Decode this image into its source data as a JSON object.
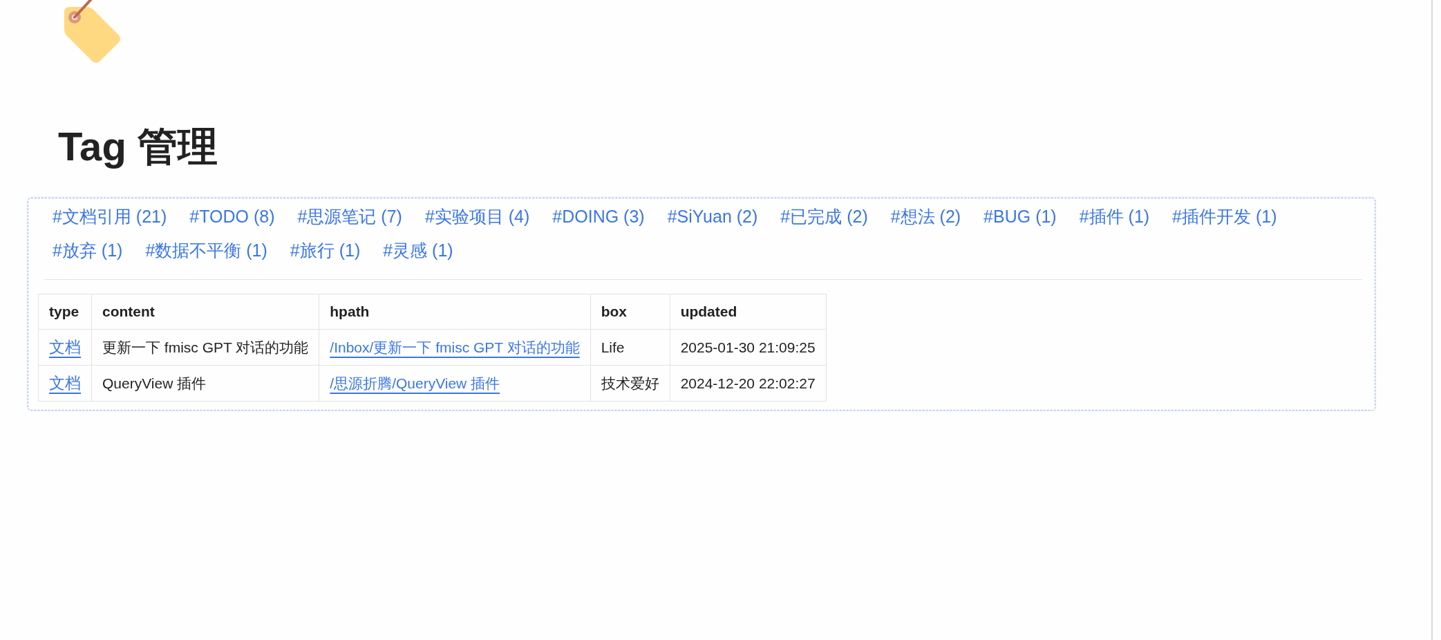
{
  "title": "Tag 管理",
  "tags": [
    "#文档引用 (21)",
    "#TODO (8)",
    "#思源笔记 (7)",
    "#实验项目 (4)",
    "#DOING (3)",
    "#SiYuan (2)",
    "#已完成 (2)",
    "#想法 (2)",
    "#BUG (1)",
    "#插件 (1)",
    "#插件开发 (1)",
    "#放弃 (1)",
    "#数据不平衡 (1)",
    "#旅行 (1)",
    "#灵感 (1)"
  ],
  "table": {
    "columns": [
      "type",
      "content",
      "hpath",
      "box",
      "updated"
    ],
    "rows": [
      {
        "type": "文档",
        "content": "更新一下 fmisc GPT 对话的功能",
        "hpath": "/Inbox/更新一下 fmisc GPT 对话的功能",
        "box": "Life",
        "updated": "2025-01-30 21:09:25"
      },
      {
        "type": "文档",
        "content": "QueryView 插件",
        "hpath": "/思源折腾/QueryView 插件",
        "box": "技术爱好",
        "updated": "2024-12-20 22:02:27"
      }
    ]
  }
}
